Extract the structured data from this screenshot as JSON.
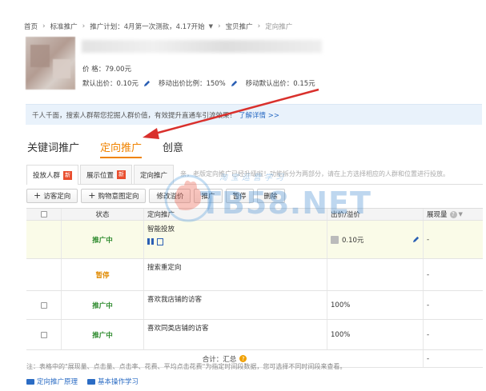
{
  "breadcrumb": {
    "home": "首页",
    "standard": "标准推广",
    "plan": "推广计划：4月第一次测款，4.17开始",
    "item": "宝贝推广",
    "current": "定向推广",
    "separator": "›"
  },
  "product": {
    "price_label": "价 格：",
    "price_value": "79.00元",
    "default_bid": "默认出价：0.10元",
    "mobile_ratio": "移动出价比例：150%",
    "mobile_bid": "移动默认出价：0.15元"
  },
  "notice": {
    "text": "千人千面，搜索人群帮您挖掘人群价值，有效提升直通车引流效果！",
    "link": "了解详情 >>"
  },
  "main_tabs": [
    "关键词推广",
    "定向推广",
    "创意"
  ],
  "sub_tabs": [
    {
      "label": "投放人群",
      "badge": "新"
    },
    {
      "label": "展示位置",
      "badge": "新"
    },
    {
      "label": "定向推广",
      "badge": ""
    }
  ],
  "sub_tab_note": "亲，老版定向推广已经升级啦！功能拆分为两部分，请在上方选择相应的人群和位置进行投放。",
  "toolbar": {
    "add_visitor": "访客定向",
    "add_intent": "购物意图定向",
    "edit_bid": "修改溢价",
    "promote": "推广",
    "pause": "暂停",
    "delete": "删除"
  },
  "table": {
    "headers": {
      "status": "状态",
      "name": "定向推广",
      "bid": "出价/溢价",
      "show": "展现量"
    },
    "rows": [
      {
        "status": "推广中",
        "status_type": "on",
        "name": "智能投放",
        "bid": "0.10元",
        "show": "-"
      },
      {
        "status": "暂停",
        "status_type": "pause",
        "name": "搜索重定向",
        "bid": "",
        "show": "-"
      },
      {
        "status": "推广中",
        "status_type": "on",
        "name": "喜欢我店铺的访客",
        "bid": "100%",
        "show": "-"
      },
      {
        "status": "推广中",
        "status_type": "on",
        "name": "喜欢同类店铺的访客",
        "bid": "100%",
        "show": "-"
      }
    ],
    "footer": "合计：汇总",
    "footer_show": "-"
  },
  "footnote": "注：表格中的\"展现量、点击量、点击率、花费、平均点击花费\"为指定时间段数据，您可选择不同时间段来查看。",
  "video_links": [
    "定向推广原理",
    "基本操作学习"
  ],
  "watermark": {
    "text": "TB58.NET",
    "sub": "淘宝运营学习"
  },
  "colors": {
    "accent": "#f08300",
    "link": "#2b6cc4",
    "arrow": "#d9302c",
    "status_on": "#2e8b2e",
    "status_pause": "#e08a00"
  }
}
